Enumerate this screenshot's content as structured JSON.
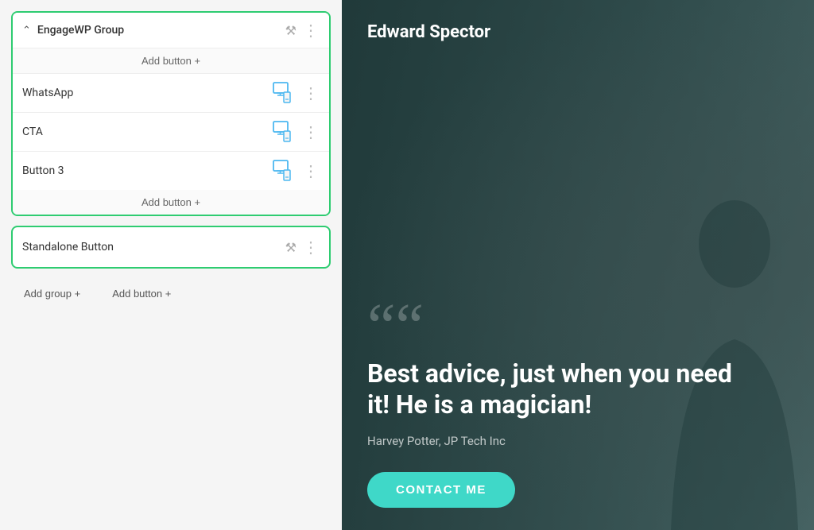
{
  "left_panel": {
    "group": {
      "name": "EngageWP Group",
      "add_button_top": "Add button +",
      "add_button_bottom": "Add button +",
      "buttons": [
        {
          "name": "WhatsApp"
        },
        {
          "name": "CTA"
        },
        {
          "name": "Button 3"
        }
      ]
    },
    "standalone": {
      "name": "Standalone Button"
    },
    "bottom_actions": {
      "add_group": "Add group +",
      "add_button": "Add button +"
    }
  },
  "right_panel": {
    "person_name": "Edward Spector",
    "quote_mark": "““",
    "quote_text": "Best advice, just when you need it! He is a magician!",
    "quote_author": "Harvey Potter, JP Tech Inc",
    "contact_button": "CONTACT ME"
  }
}
